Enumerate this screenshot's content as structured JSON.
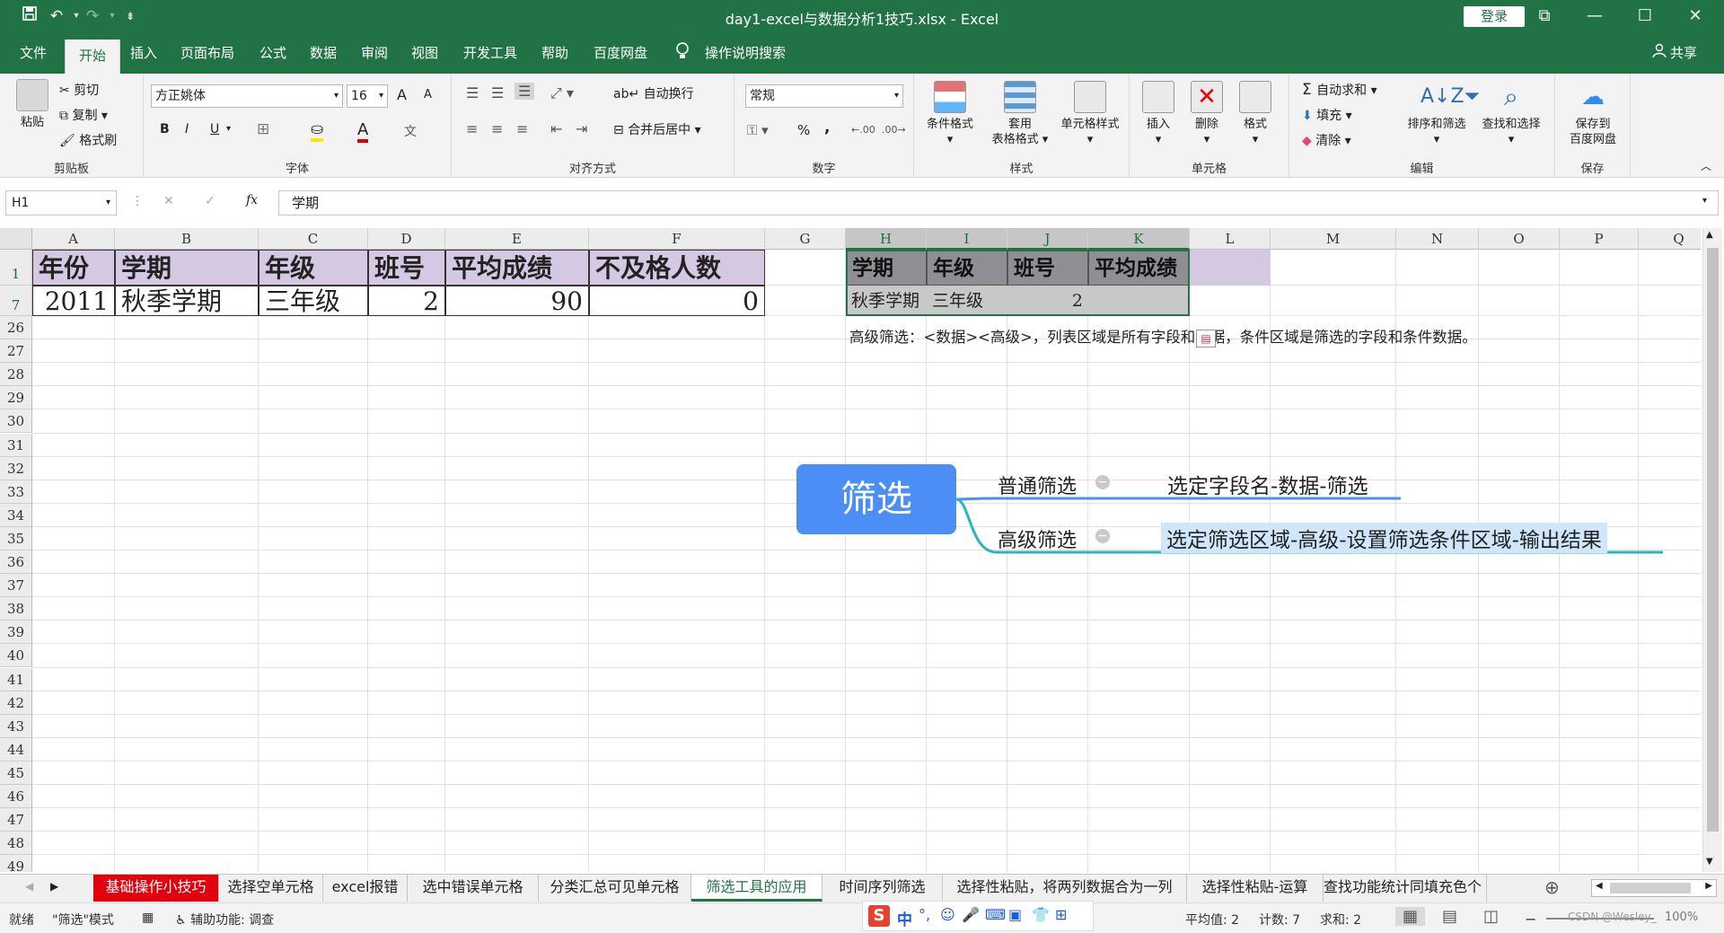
{
  "titlebar": {
    "title": "day1-excel与数据分析1技巧.xlsx - Excel",
    "login": "登录",
    "save_icon": "save-icon",
    "undo": "↶",
    "redo": "↷",
    "min": "—",
    "max": "☐",
    "close": "✕",
    "ribbon_opt": "⧉"
  },
  "menu": {
    "file": "文件",
    "home": "开始",
    "insert": "插入",
    "layout": "页面布局",
    "formula": "公式",
    "data": "数据",
    "review": "审阅",
    "view": "视图",
    "dev": "开发工具",
    "help": "帮助",
    "baidu": "百度网盘",
    "tell": "操作说明搜索",
    "share": "共享"
  },
  "ribbon": {
    "clipboard": {
      "label": "剪贴板",
      "paste": "粘贴",
      "cut": "剪切",
      "copy": "复制",
      "painter": "格式刷"
    },
    "font": {
      "label": "字体",
      "name": "方正姚体",
      "size": "16",
      "bold": "B",
      "italic": "I",
      "underline": "U",
      "grow": "A",
      "shrink": "A",
      "fontcolor": "A"
    },
    "align": {
      "label": "对齐方式",
      "wrap": "自动换行",
      "merge": "合并后居中"
    },
    "number": {
      "label": "数字",
      "format": "常规",
      "percent": "%",
      "comma": ","
    },
    "styles": {
      "label": "样式",
      "cond": "条件格式",
      "table1": "套用",
      "table2": "表格格式",
      "cellstyle": "单元格样式"
    },
    "cells": {
      "label": "单元格",
      "insert": "插入",
      "delete": "删除",
      "format": "格式"
    },
    "edit": {
      "label": "编辑",
      "autosum": "自动求和",
      "fill": "填充",
      "clear": "清除",
      "sort": "排序和筛选",
      "find": "查找和选择"
    },
    "save": {
      "label": "保存",
      "save1": "保存到",
      "save2": "百度网盘"
    }
  },
  "formula": {
    "namebox": "H1",
    "fx": "fx",
    "content": "学期"
  },
  "columns": [
    "A",
    "B",
    "C",
    "D",
    "E",
    "F",
    "G",
    "H",
    "I",
    "J",
    "K",
    "L",
    "M",
    "N",
    "O",
    "P",
    "Q"
  ],
  "rows": [
    "1",
    "7",
    "26",
    "27",
    "28",
    "29",
    "30",
    "31",
    "32",
    "33",
    "34",
    "35",
    "36",
    "37",
    "38",
    "39",
    "40",
    "41",
    "42",
    "43",
    "44",
    "45",
    "46",
    "47",
    "48",
    "49"
  ],
  "table": {
    "headers": [
      "年份",
      "学期",
      "年级",
      "班号",
      "平均成绩",
      "不及格人数"
    ],
    "values": [
      "2011",
      "秋季学期",
      "三年级",
      "2",
      "90",
      "0"
    ]
  },
  "filtered": {
    "headers": [
      "学期",
      "年级",
      "班号",
      "平均成绩"
    ],
    "values": [
      "秋季学期",
      "三年级",
      "2",
      ""
    ]
  },
  "note": "高级筛选：<数据><高级>，列表区域是所有字段和数据，条件区域是筛选的字段和条件数据。",
  "mindmap": {
    "root": "筛选",
    "branches": [
      {
        "label": "普通筛选",
        "detail": "选定字段名-数据-筛选"
      },
      {
        "label": "高级筛选",
        "detail": "选定筛选区域-高级-设置筛选条件区域-输出结果"
      }
    ],
    "colors": {
      "root": "#4a8ef6",
      "line1": "#4a8ef6",
      "line2": "#2bb5b8",
      "highlight": "#cfe6fb"
    }
  },
  "sheets": [
    "基础操作小技巧",
    "选择空单元格",
    "excel报错",
    "选中错误单元格",
    "分类汇总可见单元格",
    "筛选工具的应用",
    "时间序列筛选",
    "选择性粘贴，将两列数据合为一列",
    "选择性粘贴-运算",
    "查找功能统计同填充色个 ..."
  ],
  "status": {
    "ready": "就绪",
    "mode": "\"筛选\"模式",
    "access": "辅助功能: 调查",
    "avg": "平均值: 2",
    "count": "计数: 7",
    "sum": "求和: 2",
    "zoom": "100%",
    "ime": "中",
    "watermark": "CSDN @Wesley_"
  },
  "accent": "#217346"
}
